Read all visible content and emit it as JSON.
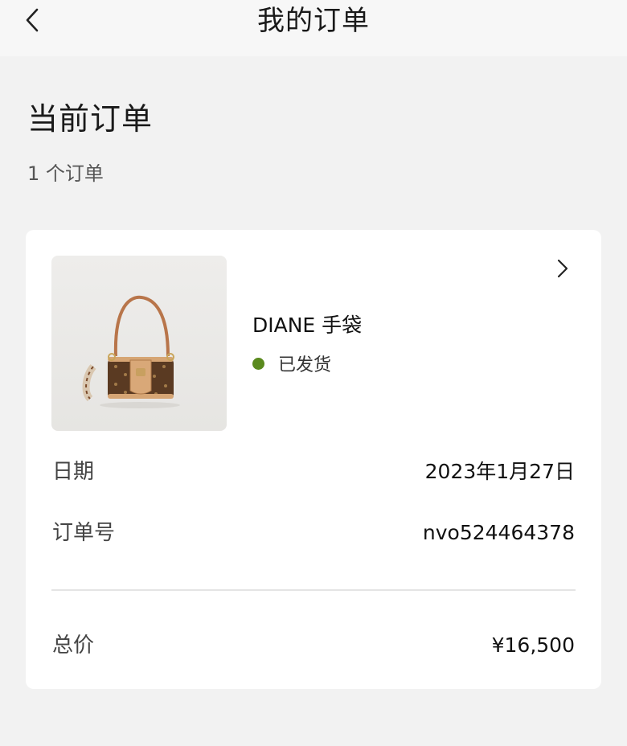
{
  "header": {
    "title": "我的订单"
  },
  "section": {
    "title": "当前订单",
    "count": "1 个订单"
  },
  "order": {
    "product_name": "DIANE 手袋",
    "status": "已发货",
    "status_color": "#5a8a1e",
    "date_label": "日期",
    "date_value": "2023年1月27日",
    "order_no_label": "订单号",
    "order_no_value": "nvo524464378",
    "total_label": "总价",
    "total_value": "¥16,500"
  },
  "icons": [
    "back-icon",
    "chevron-right-icon",
    "product-image"
  ]
}
